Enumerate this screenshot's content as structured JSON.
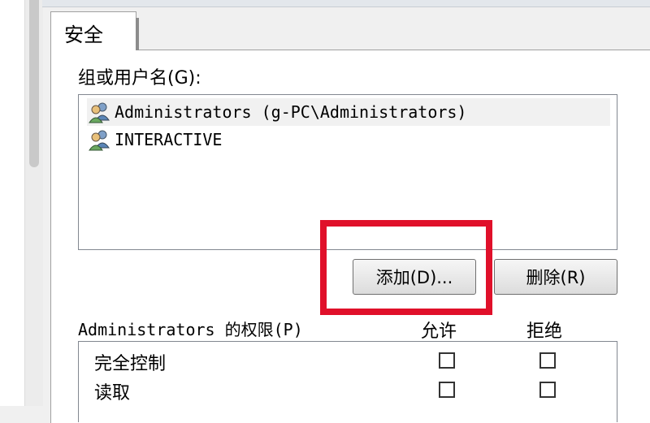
{
  "tab": {
    "label": "安全"
  },
  "group_label": "组或用户名(G):",
  "users": [
    {
      "name": "Administrators (g-PC\\Administrators)",
      "icon": "user-group-icon"
    },
    {
      "name": "INTERACTIVE",
      "icon": "user-group-icon"
    }
  ],
  "buttons": {
    "add": "添加(D)...",
    "remove": "删除(R)"
  },
  "permissions": {
    "label": "Administrators 的权限(P)",
    "allow_header": "允许",
    "deny_header": "拒绝",
    "rows": [
      {
        "name": "完全控制"
      },
      {
        "name": "读取"
      }
    ]
  },
  "colors": {
    "highlight": "#e0102a"
  }
}
